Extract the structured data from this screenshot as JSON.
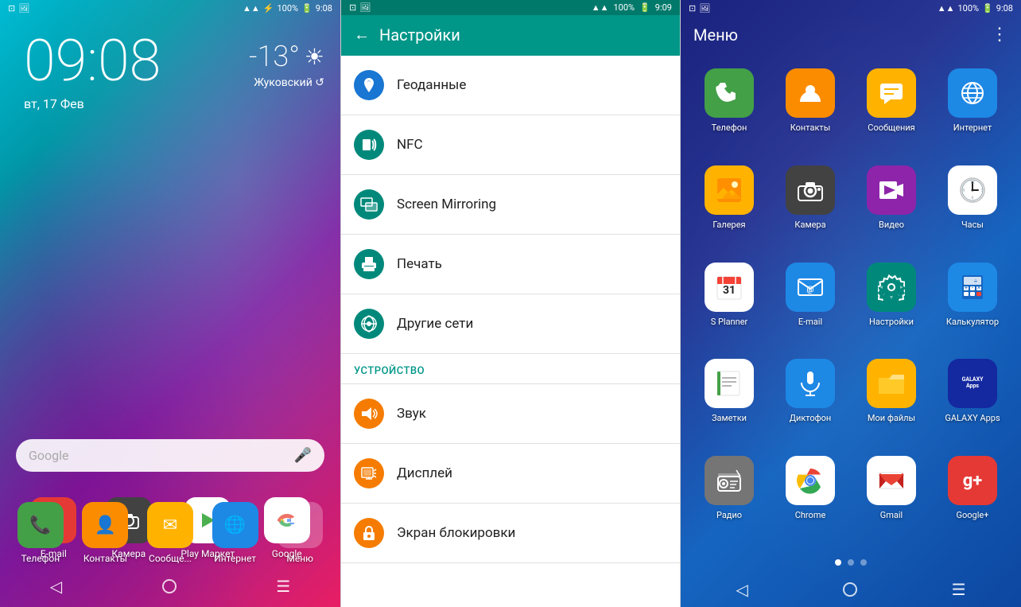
{
  "panel1": {
    "status": {
      "time": "9:08",
      "battery": "100%",
      "signal": "▲▲▲▲"
    },
    "clock": "09:08",
    "date": "вт, 17 Фев",
    "weather": {
      "temp": "-13°",
      "city": "Жуковский",
      "icon": "☀"
    },
    "search": {
      "placeholder": "Google",
      "mic_icon": "🎤"
    },
    "apps": [
      {
        "label": "E-mail",
        "bg": "#e53935",
        "icon": "@"
      },
      {
        "label": "Камера",
        "bg": "#424242",
        "icon": "📷"
      },
      {
        "label": "Play Маркет",
        "bg": "#ffffff",
        "icon": "▶"
      },
      {
        "label": "Google",
        "bg": "#ffffff",
        "icon": "G"
      }
    ],
    "nav": {
      "back": "◁",
      "home": "",
      "menu": "☰"
    },
    "bottom_apps": [
      {
        "label": "Телефон",
        "bg": "#43a047",
        "icon": "📞"
      },
      {
        "label": "Контакты",
        "bg": "#fb8c00",
        "icon": "👤"
      },
      {
        "label": "Сообще...",
        "bg": "#ffb300",
        "icon": "✉"
      },
      {
        "label": "Интернет",
        "bg": "#1e88e5",
        "icon": "🌐"
      },
      {
        "label": "Меню",
        "bg": "rgba(255,255,255,0.2)",
        "icon": "⠿"
      }
    ]
  },
  "panel2": {
    "status": {
      "time": "9:09",
      "battery": "100%"
    },
    "title": "Настройки",
    "items": [
      {
        "id": "geodata",
        "label": "Геоданные",
        "icon": "📍",
        "color": "icon-blue"
      },
      {
        "id": "nfc",
        "label": "NFC",
        "icon": "📶",
        "color": "icon-teal"
      },
      {
        "id": "screen-mirror",
        "label": "Screen Mirroring",
        "icon": "📺",
        "color": "icon-teal"
      },
      {
        "id": "print",
        "label": "Печать",
        "icon": "🖨",
        "color": "icon-teal"
      },
      {
        "id": "other-networks",
        "label": "Другие сети",
        "icon": "📡",
        "color": "icon-teal"
      }
    ],
    "section_device": "УСТРОЙСТВО",
    "device_items": [
      {
        "id": "sound",
        "label": "Звук",
        "icon": "🔊",
        "color": "icon-orange"
      },
      {
        "id": "display",
        "label": "Дисплей",
        "icon": "📱",
        "color": "icon-orange"
      },
      {
        "id": "lock-screen",
        "label": "Экран блокировки",
        "icon": "🔒",
        "color": "icon-orange"
      }
    ]
  },
  "panel3": {
    "status": {
      "time": "9:08",
      "battery": "100%"
    },
    "title": "Меню",
    "more_icon": "⋮",
    "apps": [
      {
        "id": "phone",
        "label": "Телефон",
        "bg": "#43a047",
        "icon": "phone"
      },
      {
        "id": "contacts",
        "label": "Контакты",
        "bg": "#fb8c00",
        "icon": "contact"
      },
      {
        "id": "messages",
        "label": "Сообщения",
        "bg": "#ffb300",
        "icon": "message"
      },
      {
        "id": "internet",
        "label": "Интернет",
        "bg": "#1e88e5",
        "icon": "globe"
      },
      {
        "id": "gallery",
        "label": "Галерея",
        "bg": "#ffb300",
        "icon": "gallery"
      },
      {
        "id": "camera",
        "label": "Камера",
        "bg": "#424242",
        "icon": "camera"
      },
      {
        "id": "video",
        "label": "Видео",
        "bg": "#8e24aa",
        "icon": "video"
      },
      {
        "id": "clock",
        "label": "Часы",
        "bg": "#ffffff",
        "icon": "clock"
      },
      {
        "id": "splanner",
        "label": "S Planner",
        "bg": "#ffffff",
        "icon": "calendar"
      },
      {
        "id": "email",
        "label": "E-mail",
        "bg": "#1e88e5",
        "icon": "email"
      },
      {
        "id": "settings",
        "label": "Настройки",
        "bg": "#00897b",
        "icon": "settings"
      },
      {
        "id": "calculator",
        "label": "Калькулятор",
        "bg": "#1e88e5",
        "icon": "calc"
      },
      {
        "id": "notes",
        "label": "Заметки",
        "bg": "#ffffff",
        "icon": "notes"
      },
      {
        "id": "recorder",
        "label": "Диктофон",
        "bg": "#1e88e5",
        "icon": "mic"
      },
      {
        "id": "myfiles",
        "label": "Мои файлы",
        "bg": "#ffb300",
        "icon": "folder"
      },
      {
        "id": "galaxyapps",
        "label": "GALAXY Apps",
        "bg": "#1428a0",
        "icon": "galaxy"
      },
      {
        "id": "radio",
        "label": "Радио",
        "bg": "#757575",
        "icon": "radio"
      },
      {
        "id": "chrome",
        "label": "Chrome",
        "bg": "#ffffff",
        "icon": "chrome"
      },
      {
        "id": "gmail",
        "label": "Gmail",
        "bg": "#ffffff",
        "icon": "gmail"
      },
      {
        "id": "googleplus",
        "label": "Google+",
        "bg": "#e53935",
        "icon": "gplus"
      }
    ],
    "dots": [
      true,
      false,
      false
    ],
    "nav": {
      "back": "◁",
      "home": "",
      "menu": "☰"
    }
  }
}
